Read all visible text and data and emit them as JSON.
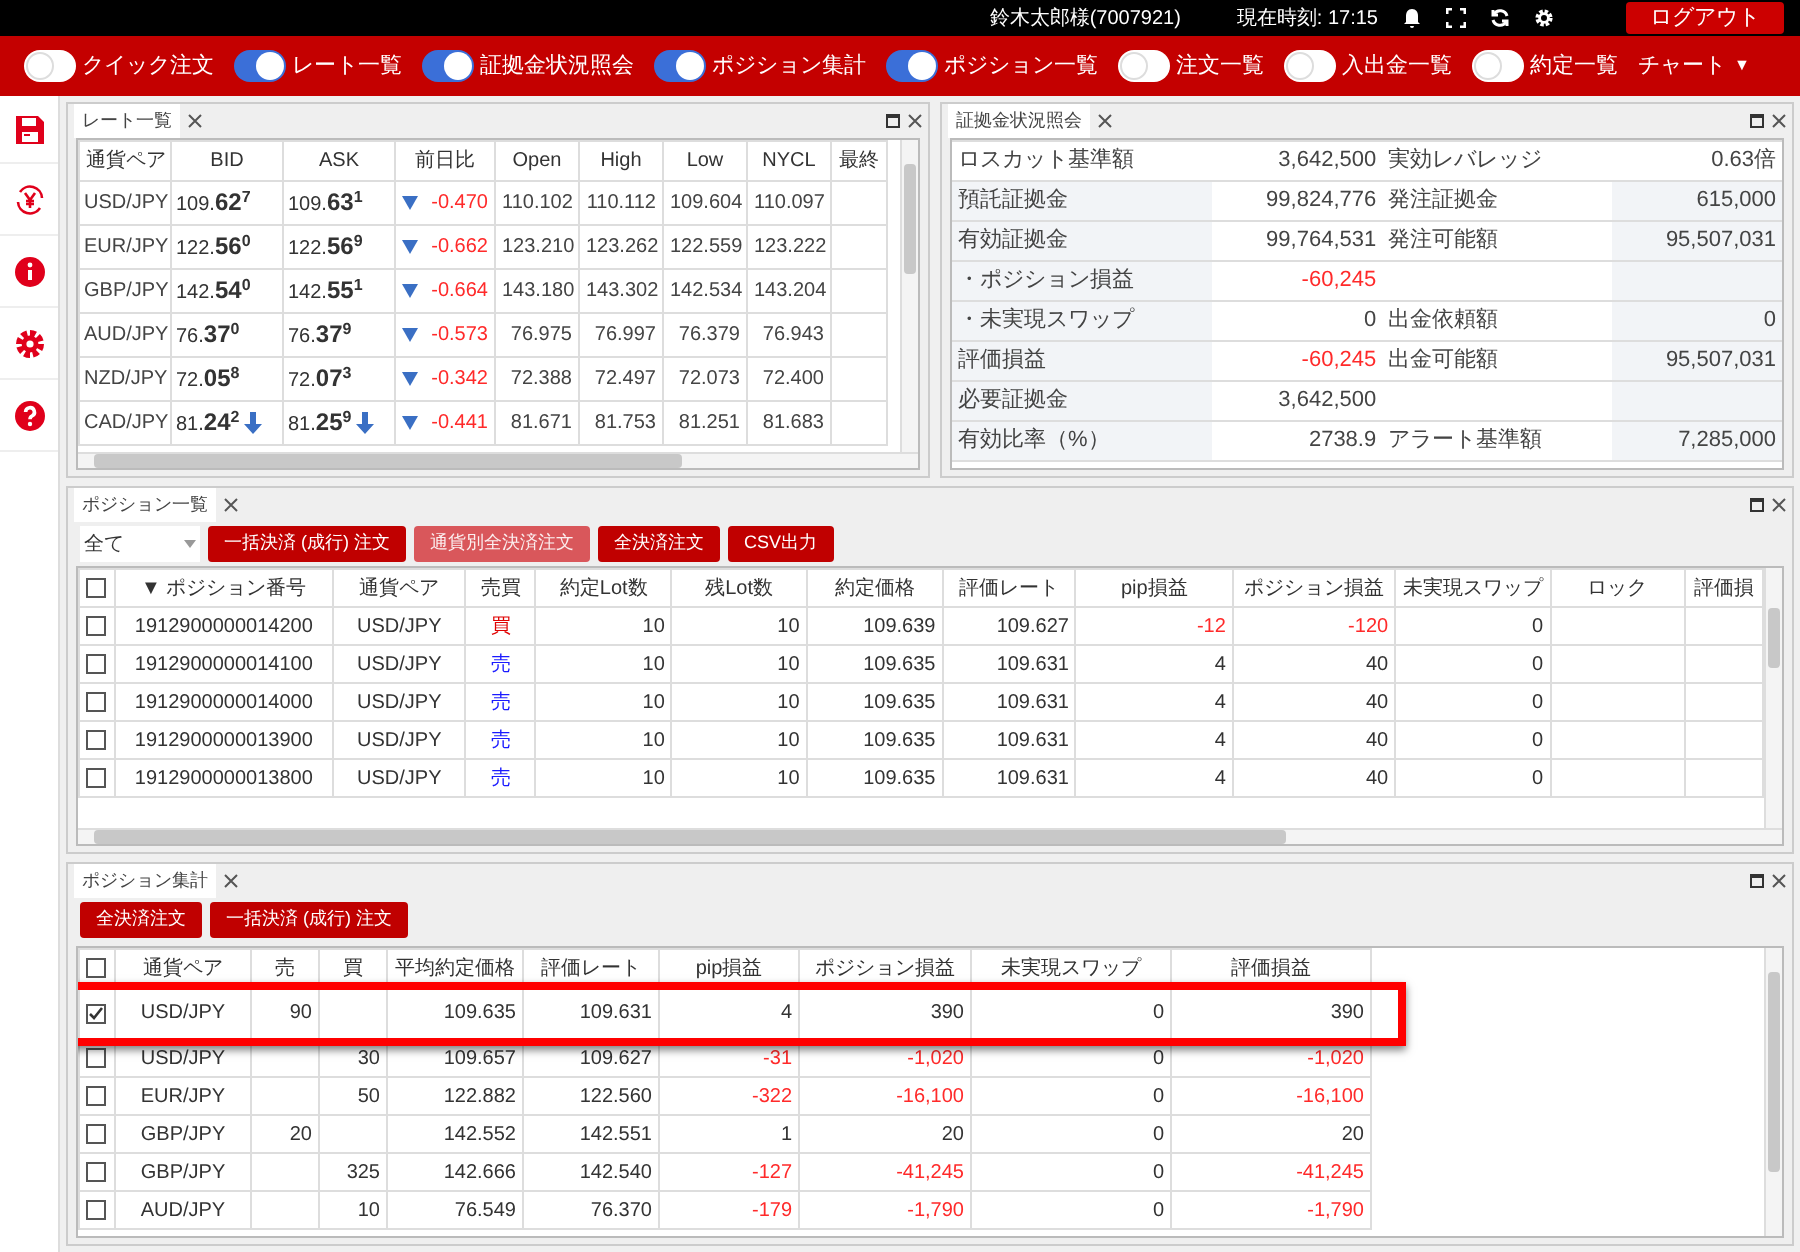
{
  "top_bar": {
    "user": "鈴木太郎様(7007921)",
    "clock": "現在時刻: 17:15",
    "logout": "ログアウト"
  },
  "toggles": [
    {
      "label": "クイック注文",
      "on": false
    },
    {
      "label": "レート一覧",
      "on": true
    },
    {
      "label": "証拠金状況照会",
      "on": true
    },
    {
      "label": "ポジション集計",
      "on": true
    },
    {
      "label": "ポジション一覧",
      "on": true
    },
    {
      "label": "注文一覧",
      "on": false
    },
    {
      "label": "入出金一覧",
      "on": false
    },
    {
      "label": "約定一覧",
      "on": false
    }
  ],
  "chart_menu": {
    "label": "チャート",
    "caret": "▼"
  },
  "rate_panel": {
    "title": "レート一覧",
    "columns": [
      "通貨ペア",
      "BID",
      "ASK",
      "前日比",
      "Open",
      "High",
      "Low",
      "NYCL",
      "最終"
    ],
    "rows": [
      {
        "pair": "USD/JPY",
        "bid": "109.**62**$^{7}$",
        "ask": "109.**63**$^{1}$",
        "change": "-0.470",
        "open": "110.102",
        "high": "110.112",
        "low": "109.604",
        "nycl": "110.097",
        "tick_down": false
      },
      {
        "pair": "EUR/JPY",
        "bid": "122.**56**$^{0}$",
        "ask": "122.**56**$^{9}$",
        "change": "-0.662",
        "open": "123.210",
        "high": "123.262",
        "low": "122.559",
        "nycl": "123.222",
        "tick_down": false
      },
      {
        "pair": "GBP/JPY",
        "bid": "142.**54**$^{0}$",
        "ask": "142.**55**$^{1}$",
        "change": "-0.664",
        "open": "143.180",
        "high": "143.302",
        "low": "142.534",
        "nycl": "143.204",
        "tick_down": false
      },
      {
        "pair": "AUD/JPY",
        "bid": "76.**37**$^{0}$",
        "ask": "76.**37**$^{9}$",
        "change": "-0.573",
        "open": "76.975",
        "high": "76.997",
        "low": "76.379",
        "nycl": "76.943",
        "tick_down": false
      },
      {
        "pair": "NZD/JPY",
        "bid": "72.**05**$^{8}$",
        "ask": "72.**07**$^{3}$",
        "change": "-0.342",
        "open": "72.388",
        "high": "72.497",
        "low": "72.073",
        "nycl": "72.400",
        "tick_down": false
      },
      {
        "pair": "CAD/JPY",
        "bid": "81.**24**$^{2}$",
        "ask": "81.**25**$^{9}$",
        "change": "-0.441",
        "open": "81.671",
        "high": "81.753",
        "low": "81.251",
        "nycl": "81.683",
        "tick_down": true
      }
    ]
  },
  "margin_panel": {
    "title": "証拠金状況照会",
    "rows": [
      {
        "label": "ロスカット基準額",
        "value": "3,642,500",
        "negative": false,
        "label_2": "実効レバレッジ",
        "value_2": "0.63倍"
      },
      {
        "label": "預託証拠金",
        "value": "99,824,776",
        "negative": false,
        "label_2": "発注証拠金",
        "value_2": "615,000"
      },
      {
        "label": "有効証拠金",
        "value": "99,764,531",
        "negative": false,
        "label_2": "発注可能額",
        "value_2": "95,507,031"
      },
      {
        "label": "・ポジション損益",
        "value": "-60,245",
        "negative": true
      },
      {
        "label": "・未実現スワップ",
        "value": "0",
        "negative": false,
        "label_2": "出金依頼額",
        "value_2": "0"
      },
      {
        "label": "評価損益",
        "value": "-60,245",
        "negative": true,
        "label_2": "出金可能額",
        "value_2": "95,507,031"
      },
      {
        "label": "必要証拠金",
        "value": "3,642,500",
        "negative": false
      },
      {
        "label": "有効比率（%）",
        "value": "2738.9",
        "negative": false,
        "label_2": "アラート基準額",
        "value_2": "7,285,000"
      }
    ]
  },
  "positions_panel": {
    "title": "ポジション一覧",
    "filter": "全て",
    "buttons": [
      {
        "label": "一括決済 (成行) 注文",
        "disabled": false
      },
      {
        "label": "通貨別全決済注文",
        "disabled": true
      },
      {
        "label": "全決済注文",
        "disabled": false
      },
      {
        "label": "CSV出力",
        "disabled": false
      }
    ],
    "columns": [
      "▼ ポジション番号",
      "通貨ペア",
      "売買",
      "約定Lot数",
      "残Lot数",
      "約定価格",
      "評価レート",
      "pip損益",
      "ポジション損益",
      "未実現スワップ",
      "ロック",
      "評価損"
    ],
    "all_checked": false,
    "rows": [
      {
        "checked": false,
        "id": "1912900000014200",
        "pair": "USD/JPY",
        "side": "買",
        "color": "#e00000",
        "lots": "10",
        "remaining": "10",
        "price": "109.639",
        "rate": "109.627",
        "pips": "-12",
        "pnl": "-120",
        "loss": true,
        "swap": "0"
      },
      {
        "checked": false,
        "id": "1912900000014100",
        "pair": "USD/JPY",
        "side": "売",
        "color": "#1a1aff",
        "lots": "10",
        "remaining": "10",
        "price": "109.635",
        "rate": "109.631",
        "pips": "4",
        "pnl": "40",
        "loss": false,
        "swap": "0"
      },
      {
        "checked": false,
        "id": "1912900000014000",
        "pair": "USD/JPY",
        "side": "売",
        "color": "#1a1aff",
        "lots": "10",
        "remaining": "10",
        "price": "109.635",
        "rate": "109.631",
        "pips": "4",
        "pnl": "40",
        "loss": false,
        "swap": "0"
      },
      {
        "checked": false,
        "id": "1912900000013900",
        "pair": "USD/JPY",
        "side": "売",
        "color": "#1a1aff",
        "lots": "10",
        "remaining": "10",
        "price": "109.635",
        "rate": "109.631",
        "pips": "4",
        "pnl": "40",
        "loss": false,
        "swap": "0"
      },
      {
        "checked": false,
        "id": "1912900000013800",
        "pair": "USD/JPY",
        "side": "売",
        "color": "#1a1aff",
        "lots": "10",
        "remaining": "10",
        "price": "109.635",
        "rate": "109.631",
        "pips": "4",
        "pnl": "40",
        "loss": false,
        "swap": "0"
      }
    ]
  },
  "summary_panel": {
    "title": "ポジション集計",
    "buttons": [
      "全決済注文",
      "一括決済 (成行) 注文"
    ],
    "columns": [
      "通貨ペア",
      "売",
      "買",
      "平均約定価格",
      "評価レート",
      "pip損益",
      "ポジション損益",
      "未実現スワップ",
      "評価損益"
    ],
    "all_checked": false,
    "rows": [
      {
        "checked": true,
        "highlighted": true,
        "pair": "USD/JPY",
        "sell": "90",
        "buy": "",
        "price": "109.635",
        "rate": "109.631",
        "pips": "4",
        "pnl": "390",
        "loss": false,
        "swap": "0",
        "eval": "390"
      },
      {
        "checked": false,
        "highlighted": false,
        "pair": "USD/JPY",
        "sell": "",
        "buy": "30",
        "price": "109.657",
        "rate": "109.627",
        "pips": "-31",
        "pnl": "-1,020",
        "loss": true,
        "swap": "0",
        "eval": "-1,020"
      },
      {
        "checked": false,
        "highlighted": false,
        "pair": "EUR/JPY",
        "sell": "",
        "buy": "50",
        "price": "122.882",
        "rate": "122.560",
        "pips": "-322",
        "pnl": "-16,100",
        "loss": true,
        "swap": "0",
        "eval": "-16,100"
      },
      {
        "checked": false,
        "highlighted": false,
        "pair": "GBP/JPY",
        "sell": "20",
        "buy": "",
        "price": "142.552",
        "rate": "142.551",
        "pips": "1",
        "pnl": "20",
        "loss": false,
        "swap": "0",
        "eval": "20"
      },
      {
        "checked": false,
        "highlighted": false,
        "pair": "GBP/JPY",
        "sell": "",
        "buy": "325",
        "price": "142.666",
        "rate": "142.540",
        "pips": "-127",
        "pnl": "-41,245",
        "loss": true,
        "swap": "0",
        "eval": "-41,245"
      },
      {
        "checked": false,
        "highlighted": false,
        "pair": "AUD/JPY",
        "sell": "",
        "buy": "10",
        "price": "76.549",
        "rate": "76.370",
        "pips": "-179",
        "pnl": "-1,790",
        "loss": true,
        "swap": "0",
        "eval": "-1,790"
      }
    ]
  }
}
